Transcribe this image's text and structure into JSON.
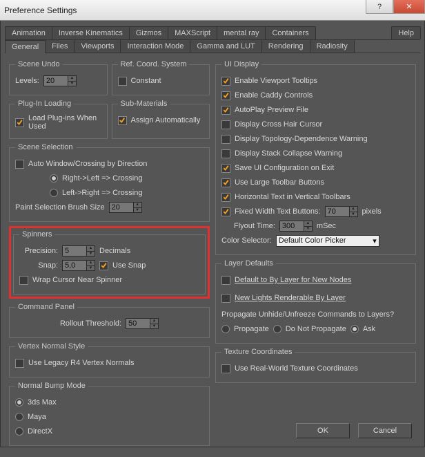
{
  "title": "Preference Settings",
  "tabs_row1": [
    "Animation",
    "Inverse Kinematics",
    "Gizmos",
    "MAXScript",
    "mental ray",
    "Containers",
    "Help"
  ],
  "tabs_row2": [
    "General",
    "Files",
    "Viewports",
    "Interaction Mode",
    "Gamma and LUT",
    "Rendering",
    "Radiosity"
  ],
  "active_tab": "General",
  "scene_undo": {
    "legend": "Scene Undo",
    "levels_label": "Levels:",
    "levels": "20"
  },
  "ref_coord": {
    "legend": "Ref. Coord. System",
    "constant": "Constant"
  },
  "plugin": {
    "legend": "Plug-In Loading",
    "load": "Load Plug-ins When Used"
  },
  "submat": {
    "legend": "Sub-Materials",
    "assign": "Assign Automatically"
  },
  "scene_sel": {
    "legend": "Scene Selection",
    "auto": "Auto Window/Crossing by Direction",
    "r2l": "Right->Left => Crossing",
    "l2r": "Left->Right => Crossing",
    "brush_label": "Paint Selection Brush Size",
    "brush": "20"
  },
  "spinners": {
    "legend": "Spinners",
    "precision_label": "Precision:",
    "precision": "5",
    "decimals": "Decimals",
    "snap_label": "Snap:",
    "snap": "5,0",
    "use_snap": "Use Snap",
    "wrap": "Wrap Cursor Near Spinner"
  },
  "cmdpanel": {
    "legend": "Command Panel",
    "thr_label": "Rollout Threshold:",
    "thr": "50"
  },
  "vnorm": {
    "legend": "Vertex Normal Style",
    "legacy": "Use Legacy R4 Vertex Normals"
  },
  "bump": {
    "legend": "Normal Bump Mode",
    "a": "3ds Max",
    "b": "Maya",
    "c": "DirectX"
  },
  "ui": {
    "legend": "UI Display",
    "items": [
      {
        "label": "Enable Viewport Tooltips",
        "c": true
      },
      {
        "label": "Enable Caddy Controls",
        "c": true
      },
      {
        "label": "AutoPlay Preview File",
        "c": true
      },
      {
        "label": "Display Cross Hair Cursor",
        "c": false
      },
      {
        "label": "Display Topology-Dependence Warning",
        "c": false
      },
      {
        "label": "Display Stack Collapse Warning",
        "c": false
      },
      {
        "label": "Save UI Configuration on Exit",
        "c": true
      },
      {
        "label": "Use Large Toolbar Buttons",
        "c": true
      },
      {
        "label": "Horizontal Text in Vertical Toolbars",
        "c": true
      }
    ],
    "fixed_width": "Fixed Width Text Buttons:",
    "fixed_val": "70",
    "pixels": "pixels",
    "flyout_label": "Flyout Time:",
    "flyout": "300",
    "msec": "mSec",
    "color_label": "Color Selector:",
    "color_val": "Default Color Picker"
  },
  "layer": {
    "legend": "Layer Defaults",
    "def": "Default to By Layer for New Nodes",
    "newl": "New Lights Renderable By Layer",
    "prop_q": "Propagate Unhide/Unfreeze Commands to Layers?",
    "r1": "Propagate",
    "r2": "Do Not Propagate",
    "r3": "Ask"
  },
  "tex": {
    "legend": "Texture Coordinates",
    "rw": "Use Real-World Texture Coordinates"
  },
  "ok": "OK",
  "cancel": "Cancel"
}
